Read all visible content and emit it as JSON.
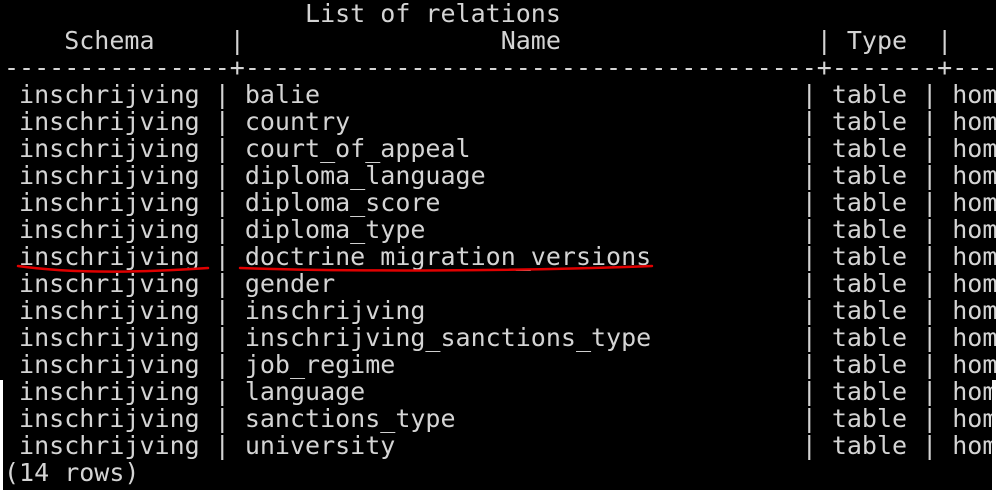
{
  "title_line": "                    List of relations",
  "header_line": "    Schema     |                 Name                 | Type  |   Owner",
  "separator_line": "---------------+--------------------------------------+-------+-----------",
  "rows": [
    " inschrijving | balie                                | table | homestead",
    " inschrijving | country                              | table | homestead",
    " inschrijving | court_of_appeal                      | table | homestead",
    " inschrijving | diploma_language                     | table | homestead",
    " inschrijving | diploma_score                        | table | homestead",
    " inschrijving | diploma_type                         | table | homestead",
    " inschrijving | doctrine_migration_versions          | table | homestead",
    " inschrijving | gender                               | table | homestead",
    " inschrijving | inschrijving                         | table | homestead",
    " inschrijving | inschrijving_sanctions_type          | table | homestead",
    " inschrijving | job_regime                           | table | homestead",
    " inschrijving | language                             | table | homestead",
    " inschrijving | sanctions_type                       | table | homestead",
    " inschrijving | university                           | table | homestead"
  ],
  "footer_line": "(14 rows)",
  "colors": {
    "background": "#000000",
    "text": "#d4d4d4",
    "annotation": "#e00000"
  }
}
